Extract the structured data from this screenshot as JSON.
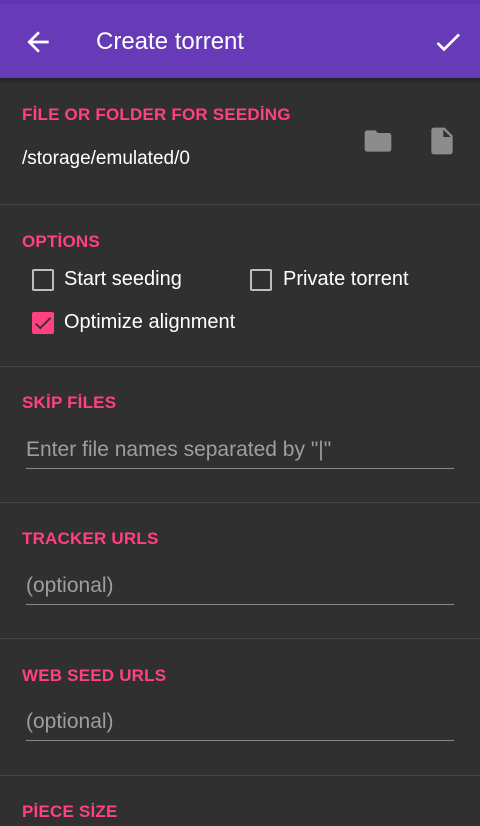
{
  "app_bar": {
    "title": "Create torrent",
    "back_icon": "arrow-back-icon",
    "done_icon": "check-icon",
    "color": "#673ab7"
  },
  "accent_color": "#ff4081",
  "source": {
    "heading": "FİLE OR FOLDER FOR SEEDİNG",
    "path": "/storage/emulated/0",
    "folder_icon": "folder-icon",
    "file_icon": "file-icon"
  },
  "options": {
    "heading": "OPTİONS",
    "start_seeding": {
      "label": "Start seeding",
      "checked": false
    },
    "private_torrent": {
      "label": "Private torrent",
      "checked": false
    },
    "optimize_alignment": {
      "label": "Optimize alignment",
      "checked": true
    }
  },
  "skip_files": {
    "heading": "SKİP FİLES",
    "placeholder": "Enter file names separated by \"|\"",
    "value": ""
  },
  "tracker_urls": {
    "heading": "TRACKER URLS",
    "placeholder": "(optional)",
    "value": ""
  },
  "web_seed_urls": {
    "heading": "WEB SEED URLS",
    "placeholder": "(optional)",
    "value": ""
  },
  "piece_size": {
    "heading": "PİECE SİZE"
  }
}
